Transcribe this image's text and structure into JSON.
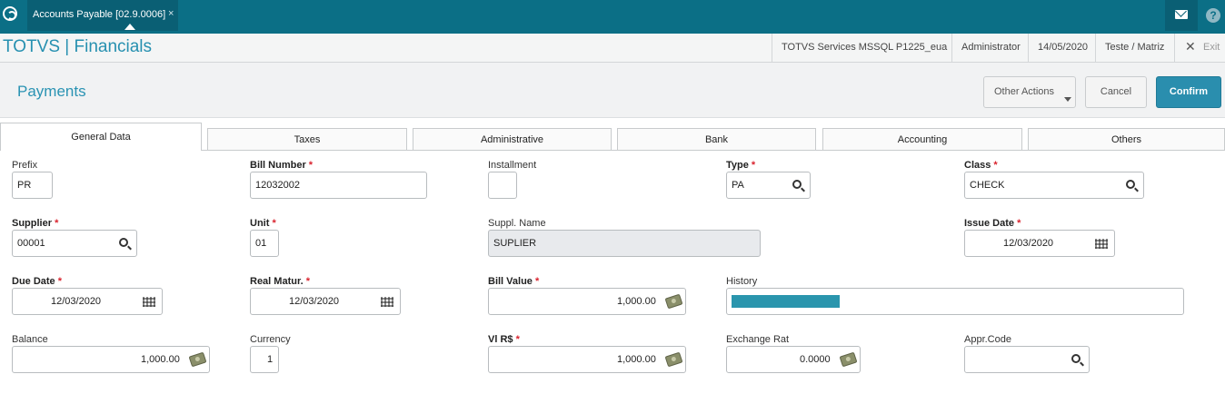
{
  "topbar": {
    "tab_title": "Accounts Payable [02.9.0006]",
    "tab_close": "×",
    "help_symbol": "?"
  },
  "header": {
    "app_title": "TOTVS | Financials",
    "environment": "TOTVS Services MSSQL P1225_eua",
    "user": "Administrator",
    "date": "14/05/2020",
    "branch": "Teste / Matriz",
    "exit_label": "Exit"
  },
  "page": {
    "title": "Payments",
    "other_actions_label": "Other Actions",
    "cancel_label": "Cancel",
    "confirm_label": "Confirm"
  },
  "tabs": [
    {
      "label": "General Data",
      "active": true
    },
    {
      "label": "Taxes",
      "active": false
    },
    {
      "label": "Administrative",
      "active": false
    },
    {
      "label": "Bank",
      "active": false
    },
    {
      "label": "Accounting",
      "active": false
    },
    {
      "label": "Others",
      "active": false
    }
  ],
  "form": {
    "prefix": {
      "label": "Prefix",
      "value": "PR"
    },
    "bill_number": {
      "label": "Bill Number",
      "value": "12032002"
    },
    "installment": {
      "label": "Installment",
      "value": ""
    },
    "type": {
      "label": "Type",
      "value": "PA"
    },
    "class": {
      "label": "Class",
      "value": "CHECK"
    },
    "supplier": {
      "label": "Supplier",
      "value": "00001"
    },
    "unit": {
      "label": "Unit",
      "value": "01"
    },
    "suppl_name": {
      "label": "Suppl. Name",
      "value": "SUPLIER"
    },
    "issue_date": {
      "label": "Issue Date",
      "value": "12/03/2020"
    },
    "due_date": {
      "label": "Due Date",
      "value": "12/03/2020"
    },
    "real_matur": {
      "label": "Real Matur.",
      "value": "12/03/2020"
    },
    "bill_value": {
      "label": "Bill Value",
      "value": "1,000.00"
    },
    "history": {
      "label": "History",
      "value": ""
    },
    "balance": {
      "label": "Balance",
      "value": "1,000.00"
    },
    "currency": {
      "label": "Currency",
      "value": "1"
    },
    "vl_rs": {
      "label": "Vl R$",
      "value": "1,000.00"
    },
    "exchange_rat": {
      "label": "Exchange Rat",
      "value": "0.0000"
    },
    "appr_code": {
      "label": "Appr.Code",
      "value": ""
    },
    "required_marker": "*"
  },
  "colors": {
    "topbar": "#0b6f86",
    "accent": "#2a8eae",
    "required": "#d9232e"
  }
}
